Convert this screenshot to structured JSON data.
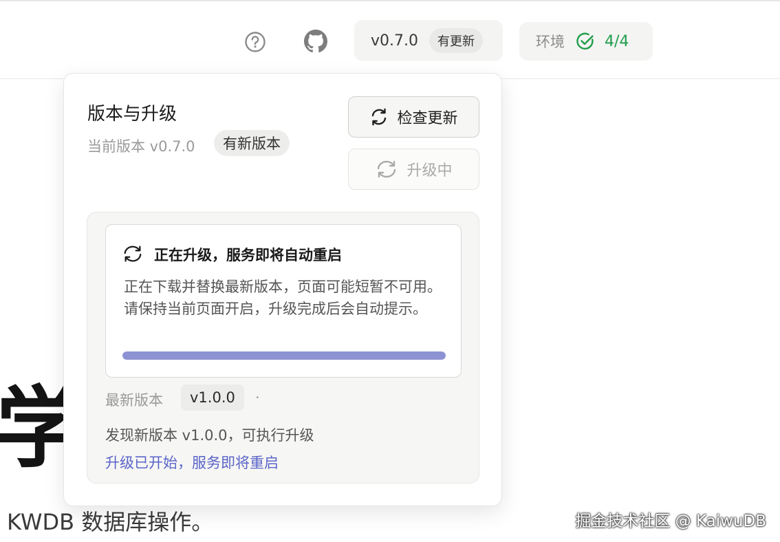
{
  "header": {
    "version": "v0.7.0",
    "update_badge": "有更新",
    "env_label": "环境",
    "env_count": "4/4",
    "icons": {
      "help": "help-circle-icon",
      "github": "github-icon",
      "env_status": "check-circle-icon"
    }
  },
  "background": {
    "heading_fragment": "学",
    "subtitle": "KWDB 数据库操作。",
    "watermark": "掘金技术社区 @ KaiwuDB"
  },
  "popover": {
    "title": "版本与升级",
    "current_version": "当前版本 v0.7.0",
    "new_version_badge": "有新版本",
    "check_update_label": "检查更新",
    "upgrading_label": "升级中",
    "notice": {
      "title": "正在升级，服务即将自动重启",
      "body": "正在下载并替换最新版本，页面可能短暂不可用。请保持当前页面开启，升级完成后会自动提示。",
      "progress": 1.0
    },
    "latest_label": "最新版本",
    "latest_version": "v1.0.0",
    "latest_separator": "·",
    "found_text": "发现新版本 v1.0.0，可执行升级",
    "started_text": "升级已开始，服务即将重启"
  },
  "colors": {
    "success": "#1f9d4a",
    "accent_link": "#5a64c9",
    "progress": "#8d92d3"
  }
}
